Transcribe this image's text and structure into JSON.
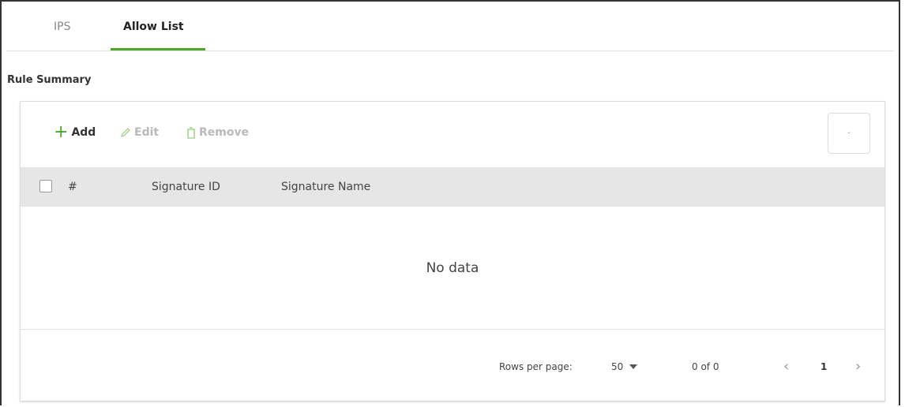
{
  "tabs": [
    {
      "label": "IPS",
      "active": false
    },
    {
      "label": "Allow List",
      "active": true
    }
  ],
  "section_title": "Rule Summary",
  "toolbar": {
    "add_label": "Add",
    "edit_label": "Edit",
    "remove_label": "Remove",
    "column_button_glyph": "·"
  },
  "table": {
    "columns": [
      "#",
      "Signature ID",
      "Signature Name"
    ],
    "empty_text": "No data"
  },
  "pagination": {
    "rows_per_page_label": "Rows per page:",
    "rows_per_page_value": "50",
    "range_text": "0 of 0",
    "current_page": "1",
    "prev_glyph": "‹",
    "next_glyph": "›"
  },
  "colors": {
    "accent": "#4aa729",
    "accent_light": "#a7d392",
    "header_bg": "#e6e6e6"
  }
}
